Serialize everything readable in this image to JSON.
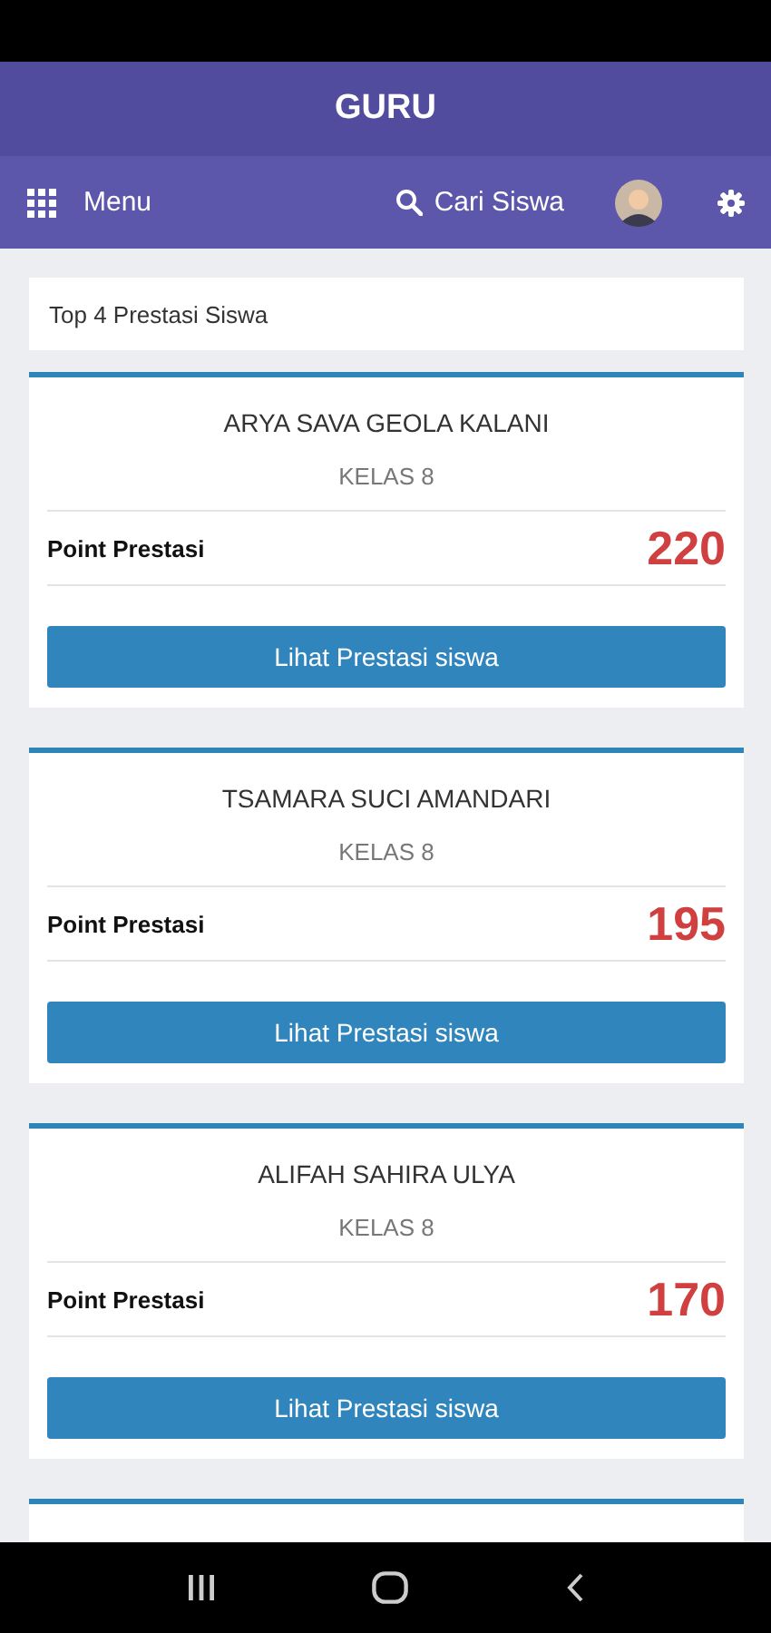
{
  "app_bar": {
    "title": "GURU"
  },
  "toolbar": {
    "menu_label": "Menu",
    "search_label": "Cari Siswa"
  },
  "section_title": "Top 4 Prestasi Siswa",
  "students": [
    {
      "name": "ARYA SAVA GEOLA KALANI",
      "class": "KELAS 8",
      "point_label": "Point Prestasi",
      "points": "220",
      "button": "Lihat Prestasi siswa"
    },
    {
      "name": "TSAMARA SUCI AMANDARI",
      "class": "KELAS 8",
      "point_label": "Point Prestasi",
      "points": "195",
      "button": "Lihat Prestasi siswa"
    },
    {
      "name": "ALIFAH SAHIRA ULYA",
      "class": "KELAS 8",
      "point_label": "Point Prestasi",
      "points": "170",
      "button": "Lihat Prestasi siswa"
    }
  ]
}
